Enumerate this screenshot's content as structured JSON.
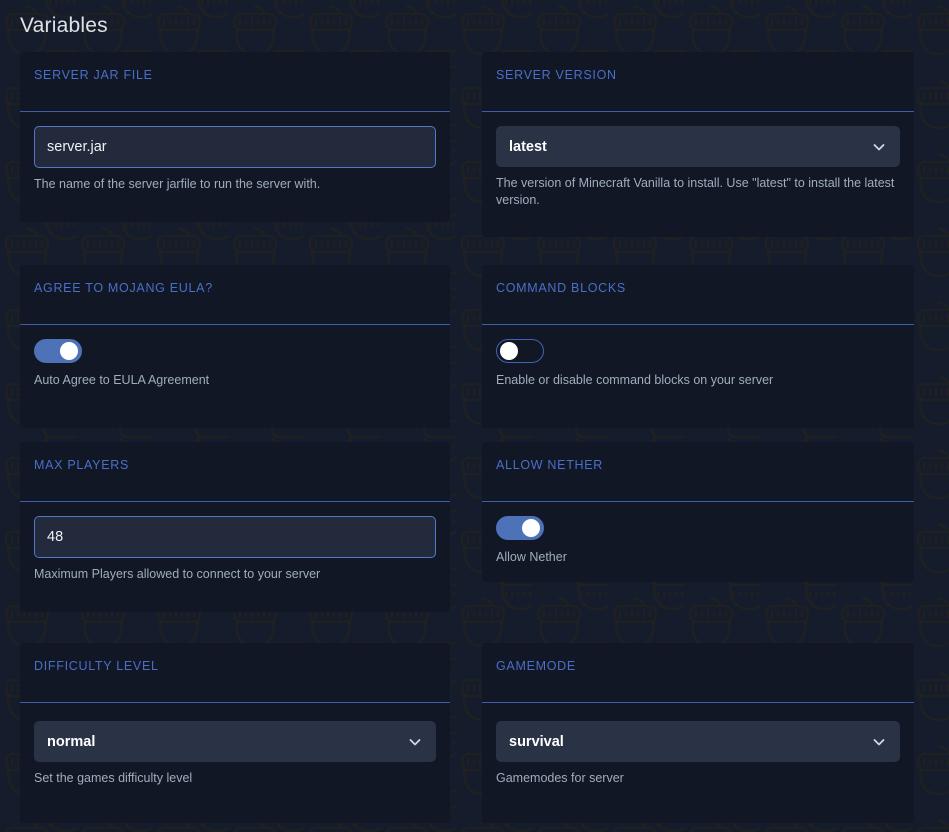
{
  "page": {
    "title": "Variables",
    "accent_color": "#4a6fc9",
    "card_bg": "#111725",
    "page_bg": "#151d2c",
    "divider_color": "#3c5ea8",
    "toggle_on_color": "#4e72b8",
    "helper_text_color": "#9fadbd"
  },
  "cards": [
    {
      "id": "server-jar-file",
      "title": "SERVER JAR FILE",
      "control": "text",
      "value": "server.jar",
      "placeholder": "",
      "helper": "The name of the server jarfile to run the server with."
    },
    {
      "id": "server-version",
      "title": "SERVER VERSION",
      "control": "select",
      "value": "latest",
      "options": [
        "latest"
      ],
      "helper": "The version of Minecraft Vanilla to install. Use \"latest\" to install the latest version."
    },
    {
      "id": "agree-to-mojang-eula",
      "title": "AGREE TO MOJANG EULA?",
      "control": "toggle",
      "value": "on",
      "helper": "Auto Agree to EULA Agreement"
    },
    {
      "id": "command-blocks",
      "title": "COMMAND BLOCKS",
      "control": "toggle",
      "value": "off",
      "helper": "Enable or disable command blocks on your server"
    },
    {
      "id": "max-players",
      "title": "MAX PLAYERS",
      "control": "text",
      "value": "48",
      "placeholder": "",
      "helper": "Maximum Players allowed to connect to your server"
    },
    {
      "id": "allow-nether",
      "title": "ALLOW NETHER",
      "control": "toggle",
      "value": "on",
      "helper": "Allow Nether"
    },
    {
      "id": "difficulty-level",
      "title": "DIFFICULTY LEVEL",
      "control": "select",
      "value": "normal",
      "options": [
        "normal"
      ],
      "helper": "Set the games difficulty level"
    },
    {
      "id": "gamemode",
      "title": "GAMEMODE",
      "control": "select",
      "value": "survival",
      "options": [
        "survival"
      ],
      "helper": "Gamemodes for server"
    }
  ],
  "icons": {
    "chevron_down": "chevron-down-icon"
  }
}
